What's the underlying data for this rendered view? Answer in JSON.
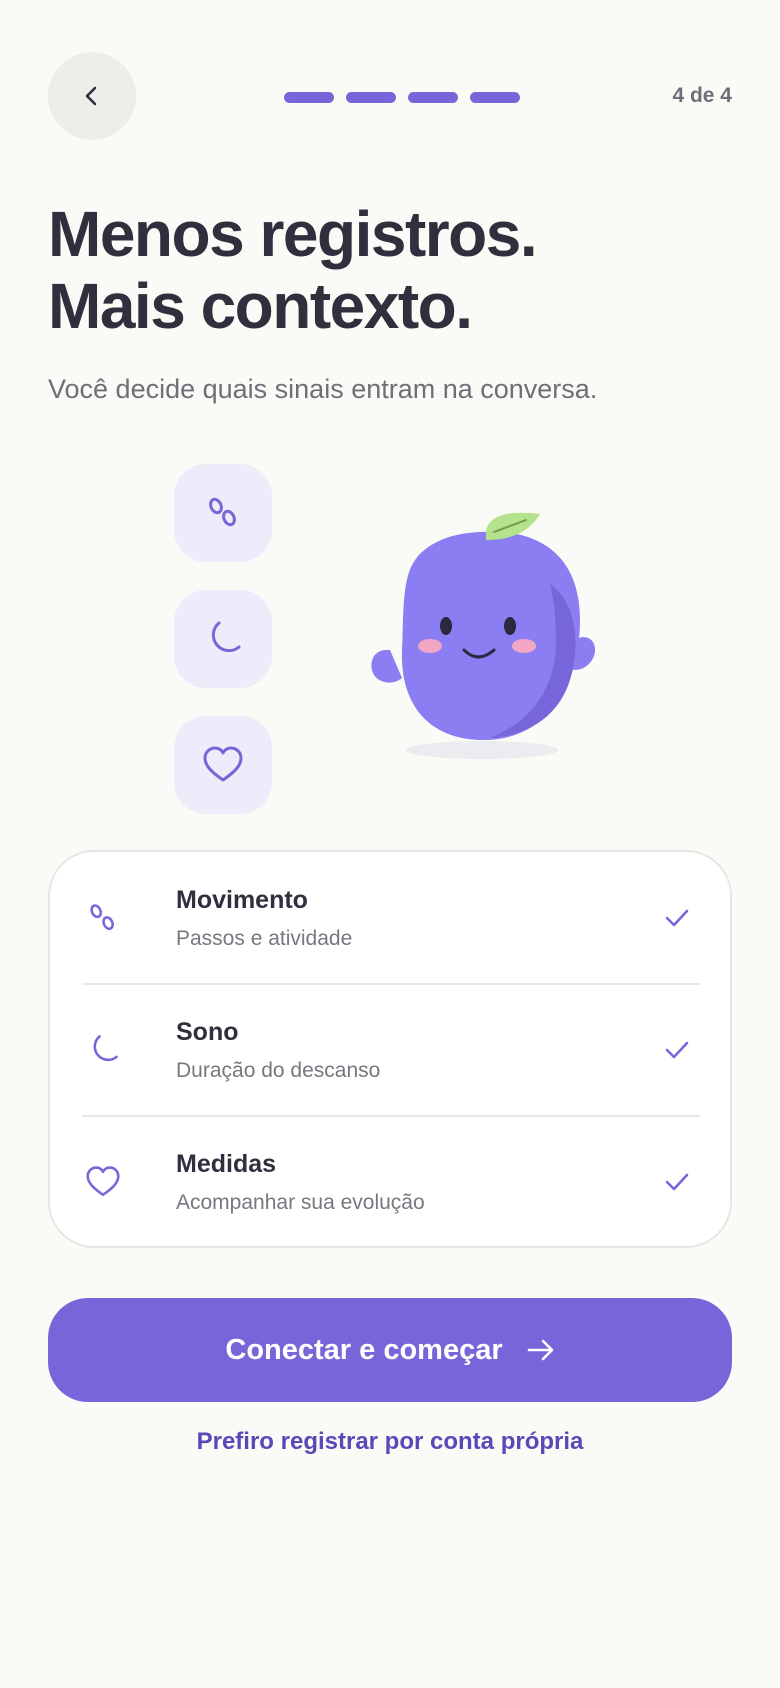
{
  "header": {
    "step_label": "4 de 4",
    "total_steps": 4,
    "current_step": 4
  },
  "hero": {
    "title_line1": "Menos registros.",
    "title_line2": "Mais contexto.",
    "subtitle": "Você decide quais sinais entram na conversa."
  },
  "signal_icons": [
    "footsteps-icon",
    "moon-icon",
    "heart-icon"
  ],
  "signals": [
    {
      "icon": "footsteps-icon",
      "name": "Movimento",
      "description": "Passos e atividade",
      "selected": true
    },
    {
      "icon": "moon-icon",
      "name": "Sono",
      "description": "Duração do descanso",
      "selected": true
    },
    {
      "icon": "heart-icon",
      "name": "Medidas",
      "description": "Acompanhar sua evolução",
      "selected": true
    }
  ],
  "actions": {
    "primary_label": "Conectar e começar",
    "secondary_label": "Prefiro registrar por conta própria"
  },
  "colors": {
    "accent": "#7766d9",
    "background": "#fafaf6",
    "tile": "#eeebfa",
    "mascot": "#8a7ef2",
    "leaf": "#b5e28c"
  }
}
